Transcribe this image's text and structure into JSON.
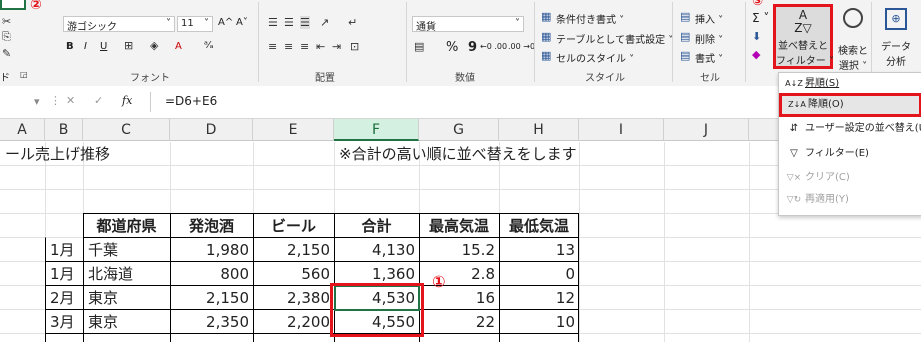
{
  "ribbon": {
    "marker_2": "②",
    "marker_3": "③",
    "clipboard": {
      "label_fragment": "ド"
    },
    "font": {
      "font_name": "游ゴシック",
      "font_size": "11",
      "grow_label": "A^",
      "shrink_label": "A˅",
      "bold": "B",
      "italic": "I",
      "underline": "U",
      "group_label": "フォント"
    },
    "alignment": {
      "group_label": "配置"
    },
    "number": {
      "format": "通貨",
      "percent": "%",
      "comma": "9",
      "dec_inc": "←0 .00",
      "dec_dec": ".00 →0",
      "group_label": "数値"
    },
    "styles": {
      "conditional": "条件付き書式 ˅",
      "table": "テーブルとして書式設定 ˅",
      "cell_style": "セルのスタイル ˅",
      "group_label": "スタイル"
    },
    "cells": {
      "insert": "挿入 ˅",
      "delete": "削除 ˅",
      "format": "書式 ˅",
      "group_label": "セル"
    },
    "editing": {
      "sigma": "Σ ˅",
      "sort_filter_line1": "並べ替えと",
      "sort_filter_line2": "フィルター ˅",
      "find_select_line1": "検索と",
      "find_select_line2": "選択 ˅"
    },
    "analysis": {
      "line1": "データ",
      "line2": "分析"
    }
  },
  "formula_bar": {
    "fx": "fx",
    "formula": "=D6+E6"
  },
  "columns": [
    "A",
    "B",
    "C",
    "D",
    "E",
    "F",
    "G",
    "H",
    "I",
    "J"
  ],
  "sheet": {
    "title": "ール売上げ推移",
    "note": "※合計の高い順に並べ替えをします",
    "headers": [
      "都道府県",
      "発泡酒",
      "ビール",
      "合計",
      "最高気温",
      "最低気温"
    ],
    "rows": [
      [
        "1月",
        "千葉",
        "1,980",
        "2,150",
        "4,130",
        "15.2",
        "13"
      ],
      [
        "1月",
        "北海道",
        "800",
        "560",
        "1,360",
        "2.8",
        "0"
      ],
      [
        "2月",
        "東京",
        "2,150",
        "2,380",
        "4,530",
        "16",
        "12"
      ],
      [
        "3月",
        "東京",
        "2,350",
        "2,200",
        "4,550",
        "22",
        "10"
      ]
    ],
    "marker_1": "①"
  },
  "sort_menu": {
    "items": [
      {
        "icon": "A↓Z",
        "label": "昇順(S)"
      },
      {
        "icon": "Z↓A",
        "label": "降順(O)"
      },
      {
        "icon": "⇵",
        "label": "ユーザー設定の並べ替え(U)"
      },
      {
        "icon": "▽",
        "label": "フィルター(E)"
      },
      {
        "icon": "▽×",
        "label": "クリア(C)"
      },
      {
        "icon": "▽↻",
        "label": "再適用(Y)"
      }
    ]
  }
}
